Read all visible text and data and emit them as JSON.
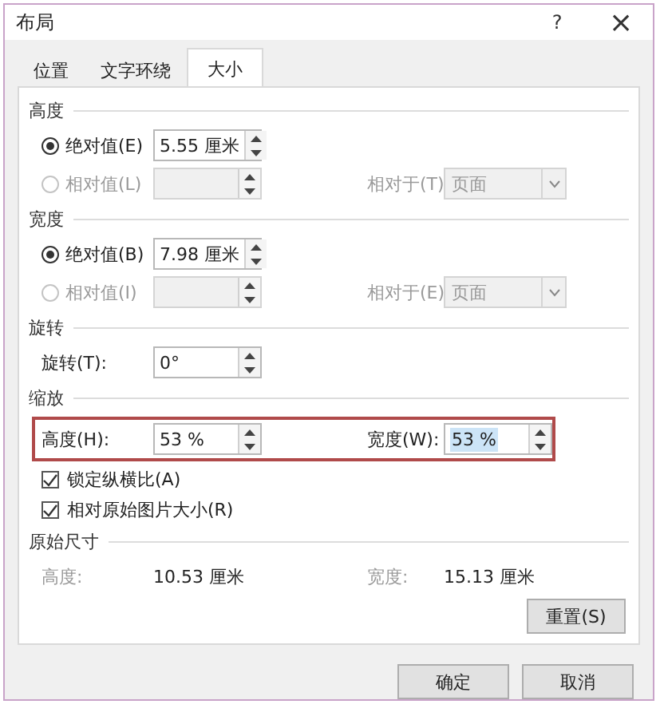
{
  "window": {
    "title": "布局",
    "help": "?",
    "close": "×"
  },
  "tabs": [
    {
      "label": "位置",
      "selected": false
    },
    {
      "label": "文字环绕",
      "selected": false
    },
    {
      "label": "大小",
      "selected": true
    }
  ],
  "sections": [
    {
      "title": "高度",
      "rows": [
        {
          "kind": "radio",
          "label": "绝对值(E)",
          "selected": true,
          "disabled": false,
          "value": "5.55 厘米"
        },
        {
          "kind": "radio",
          "label": "相对值(L)",
          "selected": false,
          "disabled": true,
          "relative": {
            "label": "相对于(T)",
            "value": "页面"
          }
        }
      ]
    },
    {
      "title": "宽度",
      "rows": [
        {
          "kind": "radio",
          "label": "绝对值(B)",
          "selected": true,
          "disabled": false,
          "value": "7.98 厘米"
        },
        {
          "kind": "radio",
          "label": "相对值(I)",
          "selected": false,
          "disabled": true,
          "relative": {
            "label": "相对于(E)",
            "value": "页面"
          }
        }
      ]
    },
    {
      "title": "旋转",
      "rows": [
        {
          "kind": "spin",
          "label": "旋转(T):",
          "value": "0°"
        }
      ]
    },
    {
      "title": "缩放",
      "rows": [
        {
          "kind": "pair",
          "outlined": true,
          "fields": [
            {
              "label": "高度(H):",
              "value": "53 %",
              "text_selected": false
            },
            {
              "label": "宽度(W):",
              "value": "53 %",
              "text_selected": true
            }
          ]
        },
        {
          "kind": "checkbox",
          "label": "锁定纵横比(A)",
          "checked": true
        },
        {
          "kind": "checkbox",
          "label": "相对原始图片大小(R)",
          "checked": true
        }
      ]
    },
    {
      "title": "原始尺寸",
      "rows": [
        {
          "kind": "info",
          "fields": [
            {
              "label": "高度:",
              "value": "10.53 厘米"
            },
            {
              "label": "宽度:",
              "value": "15.13 厘米"
            }
          ]
        }
      ]
    }
  ],
  "reset_button": "重置(S)",
  "buttons": [
    "确定",
    "取消"
  ]
}
